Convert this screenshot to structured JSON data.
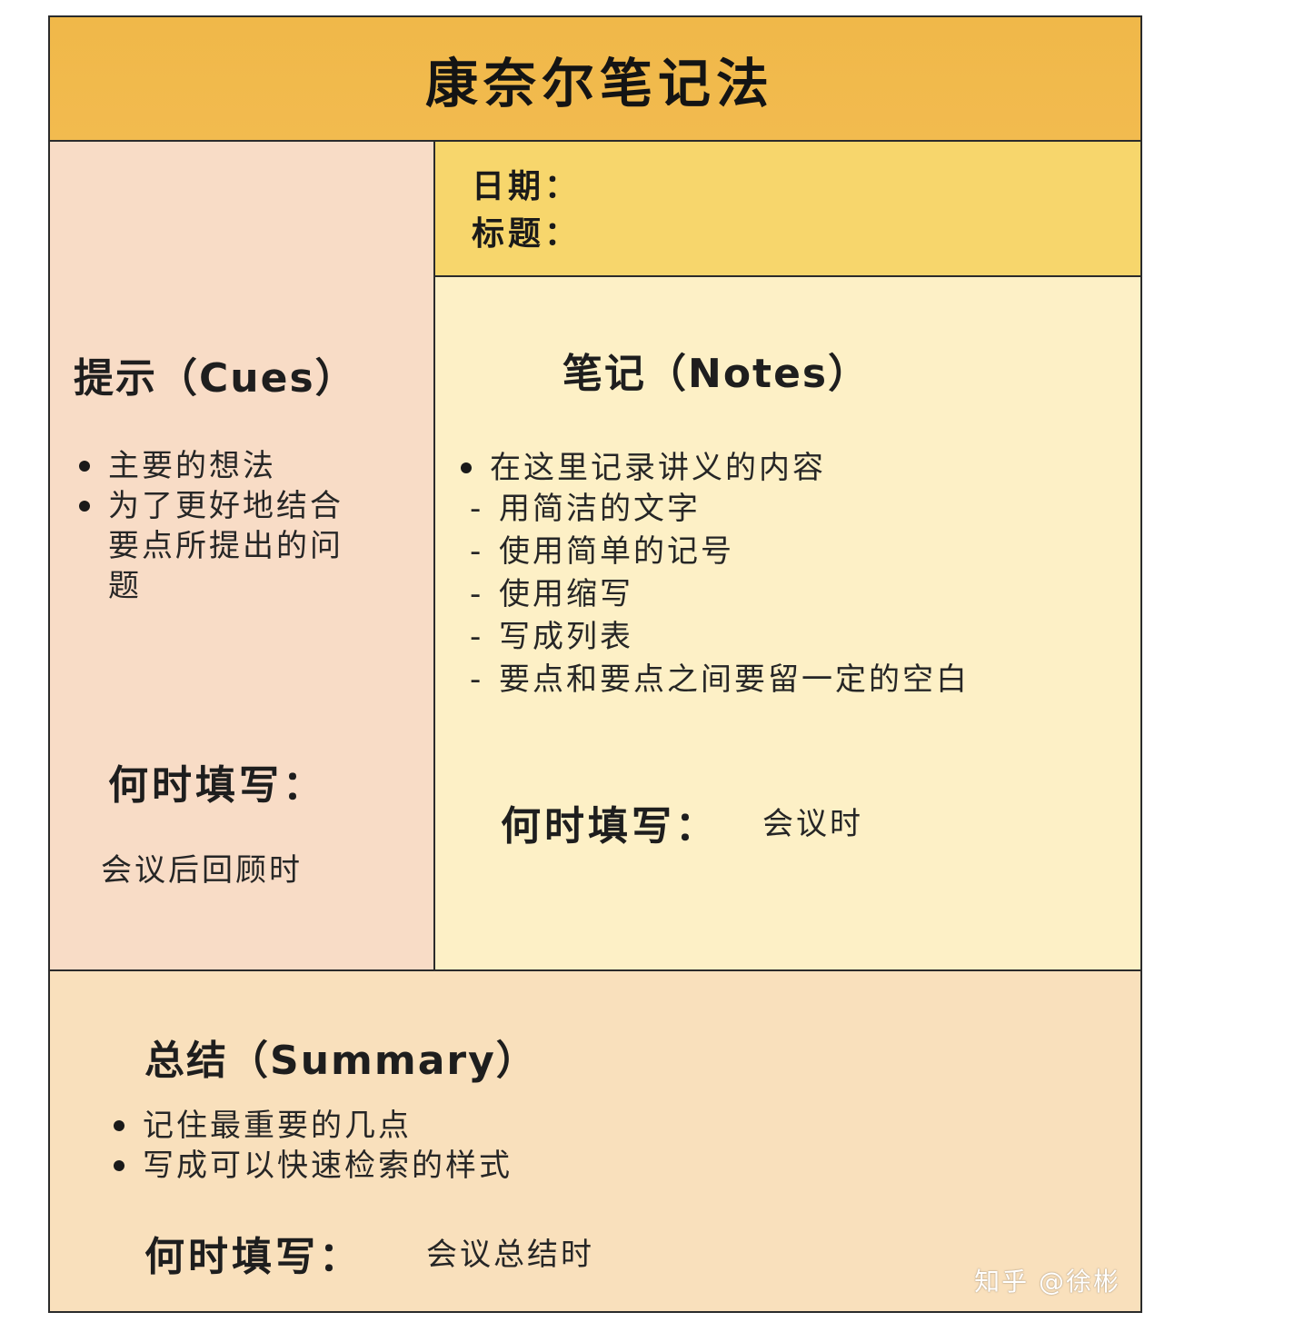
{
  "title": "康奈尔笔记法",
  "meta": {
    "date_label": "日期：",
    "subject_label": "标题："
  },
  "cues": {
    "heading": "提示（Cues）",
    "items": [
      "主要的想法",
      "为了更好地结合要点所提出的问题"
    ],
    "when_label": "何时填写：",
    "when_value": "会议后回顾时"
  },
  "notes": {
    "heading": "笔记（Notes）",
    "lead": "在这里记录讲义的内容",
    "sub_items": [
      "用简洁的文字",
      "使用简单的记号",
      "使用缩写",
      "写成列表",
      "要点和要点之间要留一定的空白"
    ],
    "when_label": "何时填写：",
    "when_value": "会议时"
  },
  "summary": {
    "heading": "总结（Summary）",
    "items": [
      "记住最重要的几点",
      "写成可以快速检索的样式"
    ],
    "when_label": "何时填写：",
    "when_value": "会议总结时"
  },
  "watermark": "知乎 @徐彬",
  "colors": {
    "title_bar": "#f0b849",
    "meta_box": "#f7d66c",
    "cues_panel": "#f8dcc6",
    "notes_panel": "#fdf0c6",
    "summary_panel": "#f9e0bc",
    "border": "#2b2b2b"
  }
}
